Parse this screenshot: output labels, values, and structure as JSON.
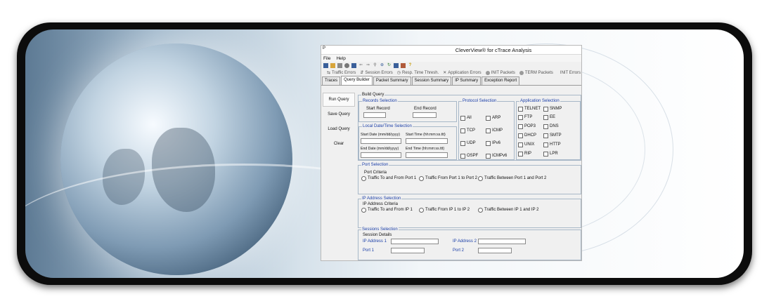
{
  "window": {
    "icon_label": "P",
    "title": "CleverView® for cTrace Analysis"
  },
  "menu": [
    "File",
    "Help"
  ],
  "toolbar_icons": [
    "save-icon",
    "open-icon",
    "print-icon",
    "stop-icon",
    "grid-icon",
    "back-icon",
    "forward-icon",
    "search-icon",
    "zoom-icon",
    "refresh-icon",
    "report-icon",
    "copy-icon",
    "help-icon"
  ],
  "filters": [
    {
      "label": "Traffic Errors",
      "icon": "traffic-errors-icon"
    },
    {
      "label": "Session Errors",
      "icon": "session-errors-icon"
    },
    {
      "label": "Resp. Time Thresh.",
      "icon": "clock-icon"
    },
    {
      "label": "Application Errors",
      "icon": "tools-icon"
    },
    {
      "label": "INIT Packets",
      "icon": "dot-icon"
    },
    {
      "label": "TERM Packets",
      "icon": "dot-icon"
    },
    {
      "label": "INIT Errors",
      "icon": "none"
    }
  ],
  "tabs": [
    "Traces",
    "Query Builder",
    "Packet Summary",
    "Session Summary",
    "IP Summary",
    "Exception Report"
  ],
  "active_tab": "Query Builder",
  "side_buttons": [
    "Run Query",
    "Save Query",
    "Load Query",
    "Clear"
  ],
  "build_query": {
    "legend": "Build Query",
    "records": {
      "legend": "Records Selection",
      "start": "Start Record",
      "end": "End Record"
    },
    "datetime": {
      "legend": "Local Date/Time Selection",
      "start_date": "Start Date (mm/dd/yyyy)",
      "start_time": "Start Time (hh:mm:ss.ttt)",
      "end_date": "End Date (mm/dd/yyyy)",
      "end_time": "End Time (hh:mm:ss.ttt)"
    },
    "protocol": {
      "legend": "Protocol Selection",
      "options": [
        "All",
        "ARP",
        "TCP",
        "ICMP",
        "UDP",
        "IPv6",
        "OSPF",
        "ICMPv6"
      ]
    },
    "application": {
      "legend": "Application Selection",
      "options": [
        "TELNET",
        "SNMP",
        "FTP",
        "EE",
        "POP3",
        "DNS",
        "DHCP",
        "SMTP",
        "UNIX",
        "HTTP",
        "RIP",
        "LPR"
      ]
    }
  },
  "port": {
    "legend": "Port Selection",
    "criteria": "Port  Criteria",
    "options": [
      "Traffic To and From Port 1",
      "Traffic From Port 1 to Port 2",
      "Traffic Between Port 1 and Port 2"
    ]
  },
  "ip": {
    "legend": "IP Address Selection",
    "criteria": "IP Address Criteria",
    "options": [
      "Traffic To and From IP 1",
      "Traffic From IP 1 to IP 2",
      "Traffic Between IP 1 and IP 2"
    ]
  },
  "sessions": {
    "legend": "Sessions Selection",
    "details": "Session Details",
    "ip1": "IP Address 1",
    "ip2": "IP Address 2",
    "port1": "Port 1",
    "port2": "Port 2"
  }
}
